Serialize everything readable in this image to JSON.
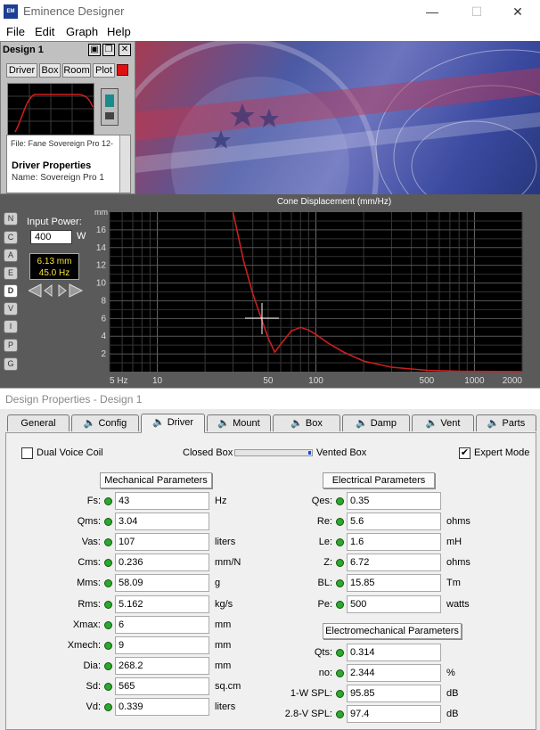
{
  "window": {
    "title": "Eminence Designer",
    "minimize": "—",
    "maximize": "☐",
    "close": "✕"
  },
  "menu": [
    "File",
    "Edit",
    "Graph",
    "Help"
  ],
  "design": {
    "title": "Design 1",
    "tabs": [
      "Driver",
      "Box",
      "Room",
      "Plot"
    ],
    "file_label": "File: Fane Sovereign Pro 12-",
    "driver_properties": "Driver Properties",
    "name_line": "Name: Sovereign Pro 1"
  },
  "side_buttons": [
    "N",
    "C",
    "A",
    "E",
    "D",
    "V",
    "I",
    "P",
    "G"
  ],
  "input_power": {
    "label": "Input Power:",
    "value": "400",
    "unit": "W"
  },
  "readout": {
    "mm": "6.13 mm",
    "hz": "45.0 Hz"
  },
  "graph": {
    "title": "Cone Displacement (mm/Hz)",
    "y_unit": "mm",
    "y_ticks": [
      "16",
      "14",
      "12",
      "10",
      "8",
      "6",
      "4",
      "2"
    ],
    "x_ticks": [
      "5 Hz",
      "10",
      "50",
      "100",
      "500",
      "1000",
      "2000"
    ]
  },
  "chart_data": {
    "type": "line",
    "title": "Cone Displacement (mm/Hz)",
    "xlabel": "",
    "ylabel": "mm",
    "x_scale": "log",
    "xlim": [
      5,
      2000
    ],
    "ylim": [
      0,
      18
    ],
    "grid": true,
    "series": [
      {
        "x": [
          30,
          35,
          40,
          45,
          50,
          55,
          60,
          70,
          80,
          90,
          100,
          120,
          150,
          200,
          300,
          500,
          800,
          1000,
          2000
        ],
        "y": [
          18,
          12.5,
          8.8,
          6.13,
          3.8,
          2.2,
          3.1,
          4.6,
          5.0,
          4.7,
          4.2,
          3.2,
          2.2,
          1.2,
          0.5,
          0.15,
          0.05,
          0.03,
          0.01
        ]
      }
    ],
    "color": "#cc1f1f"
  },
  "props": {
    "title": "Design Properties - Design 1",
    "tabs": [
      "General",
      "Config",
      "Driver",
      "Mount",
      "Box",
      "Damp",
      "Vent",
      "Parts"
    ],
    "active_tab": "Driver",
    "dual_voice_coil": "Dual Voice Coil",
    "closed_box": "Closed Box",
    "vented_box": "Vented Box",
    "expert_mode": "Expert Mode",
    "expert_mode_checked": "✔",
    "mechanical_header": "Mechanical Parameters",
    "electrical_header": "Electrical Parameters",
    "electromech_header": "Electromechanical Parameters",
    "mechanical": [
      {
        "label": "Fs:",
        "value": "43",
        "unit": "Hz"
      },
      {
        "label": "Qms:",
        "value": "3.04",
        "unit": ""
      },
      {
        "label": "Vas:",
        "value": "107",
        "unit": "liters"
      },
      {
        "label": "Cms:",
        "value": "0.236",
        "unit": "mm/N"
      },
      {
        "label": "Mms:",
        "value": "58.09",
        "unit": "g"
      },
      {
        "label": "Rms:",
        "value": "5.162",
        "unit": "kg/s"
      },
      {
        "label": "Xmax:",
        "value": "6",
        "unit": "mm"
      },
      {
        "label": "Xmech:",
        "value": "9",
        "unit": "mm"
      },
      {
        "label": "Dia:",
        "value": "268.2",
        "unit": "mm"
      },
      {
        "label": "Sd:",
        "value": "565",
        "unit": "sq.cm"
      },
      {
        "label": "Vd:",
        "value": "0.339",
        "unit": "liters"
      }
    ],
    "electrical": [
      {
        "label": "Qes:",
        "value": "0.35",
        "unit": ""
      },
      {
        "label": "Re:",
        "value": "5.6",
        "unit": "ohms"
      },
      {
        "label": "Le:",
        "value": "1.6",
        "unit": "mH"
      },
      {
        "label": "Z:",
        "value": "6.72",
        "unit": "ohms"
      },
      {
        "label": "BL:",
        "value": "15.85",
        "unit": "Tm"
      },
      {
        "label": "Pe:",
        "value": "500",
        "unit": "watts"
      }
    ],
    "electromech": [
      {
        "label": "Qts:",
        "value": "0.314",
        "unit": ""
      },
      {
        "label": "no:",
        "value": "2.344",
        "unit": "%"
      },
      {
        "label": "1-W SPL:",
        "value": "95.85",
        "unit": "dB"
      },
      {
        "label": "2.8-V SPL:",
        "value": "97.4",
        "unit": "dB"
      }
    ]
  }
}
